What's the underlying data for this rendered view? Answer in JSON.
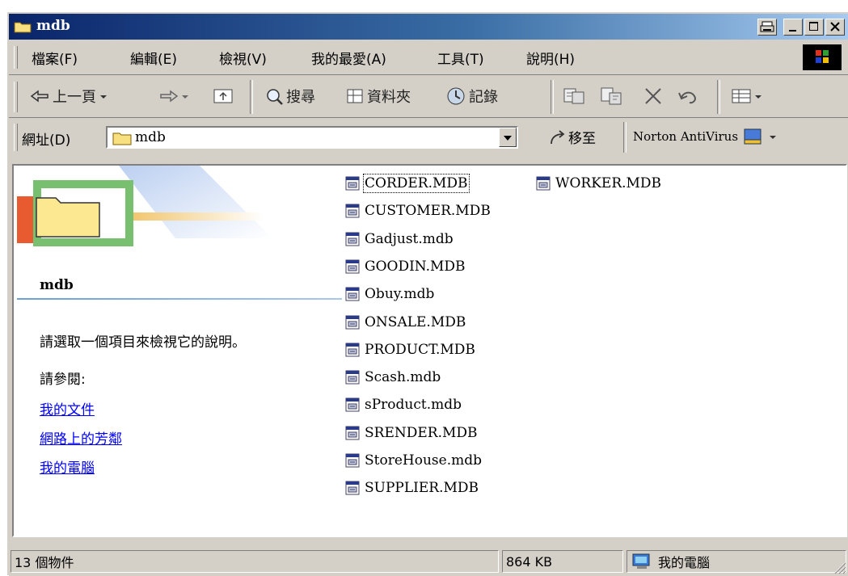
{
  "window": {
    "title": "mdb"
  },
  "menu": [
    "檔案(F)",
    "編輯(E)",
    "檢視(V)",
    "我的最愛(A)",
    "工具(T)",
    "說明(H)"
  ],
  "toolbar": {
    "back": "上一頁",
    "search": "搜尋",
    "folders": "資料夾",
    "history": "記錄"
  },
  "address": {
    "label": "網址(D)",
    "value": "mdb",
    "go": "移至",
    "norton": "Norton AntiVirus"
  },
  "left_pane": {
    "folder_name": "mdb",
    "description": "請選取一個項目來檢視它的說明。",
    "see_also": "請參閱:",
    "links": [
      "我的文件",
      "網路上的芳鄰",
      "我的電腦"
    ]
  },
  "files": [
    "CORDER.MDB",
    "CUSTOMER.MDB",
    "Gadjust.mdb",
    "GOODIN.MDB",
    "Obuy.mdb",
    "ONSALE.MDB",
    "PRODUCT.MDB",
    "Scash.mdb",
    "sProduct.mdb",
    "SRENDER.MDB",
    "StoreHouse.mdb",
    "SUPPLIER.MDB",
    "WORKER.MDB"
  ],
  "status": {
    "objects": "13 個物件",
    "size": "864 KB",
    "location": "我的電腦"
  },
  "colors": {
    "face": "#d4d0c8",
    "title_start": "#0a246a",
    "title_end": "#a6caf0",
    "link": "#0000ff"
  },
  "icons": [
    "folder-icon",
    "back-arrow-icon",
    "forward-arrow-icon",
    "up-folder-icon",
    "search-icon",
    "folders-icon",
    "history-icon",
    "move-to-icon",
    "copy-to-icon",
    "delete-icon",
    "undo-icon",
    "views-icon",
    "go-arrow-icon",
    "norton-icon",
    "access-database-icon",
    "my-computer-icon"
  ]
}
